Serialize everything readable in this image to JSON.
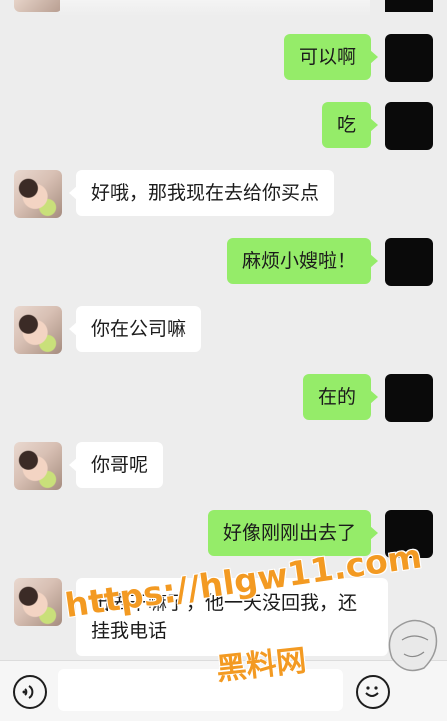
{
  "messages": [
    {
      "side": "self",
      "text": "可以啊"
    },
    {
      "side": "self",
      "text": "吃"
    },
    {
      "side": "other",
      "text": "好哦，那我现在去给你买点"
    },
    {
      "side": "self",
      "text": "麻烦小嫂啦！"
    },
    {
      "side": "other",
      "text": "你在公司嘛"
    },
    {
      "side": "self",
      "text": "在的"
    },
    {
      "side": "other",
      "text": "你哥呢"
    },
    {
      "side": "self",
      "text": "好像刚刚出去了"
    },
    {
      "side": "other",
      "text": "出去干嘛了，他一天没回我，还挂我电话"
    }
  ],
  "watermark": {
    "url": "https://hlgw11.com",
    "brand": "黑料网"
  },
  "icons": {
    "voice": "voice-icon",
    "emoji": "emoji-icon"
  },
  "colors": {
    "self_bubble": "#95ec69",
    "other_bubble": "#ffffff",
    "background": "#ededed",
    "watermark": "#f39a22"
  }
}
